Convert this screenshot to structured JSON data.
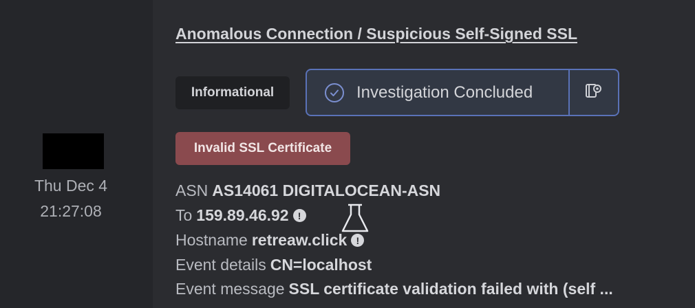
{
  "event": {
    "date": "Thu Dec 4",
    "time": "21:27:08",
    "title": "Anomalous Connection / Suspicious Self-Signed SSL",
    "severity": "Informational",
    "status_label": "Investigation Concluded",
    "tag": "Invalid SSL Certificate",
    "details": {
      "asn_label": "ASN",
      "asn_value": "AS14061 DIGITALOCEAN-ASN",
      "to_label": "To",
      "to_value": "159.89.46.92",
      "hostname_label": "Hostname",
      "hostname_value": "retreaw.click",
      "event_details_label": "Event details",
      "event_details_value": "CN=localhost",
      "event_message_label": "Event message",
      "event_message_value": "SSL certificate validation failed with (self ..."
    },
    "info_glyph": "!"
  },
  "colors": {
    "status_border": "#5a72b8",
    "tag_bg": "#8a4a4e",
    "bg": "#2b2c30"
  },
  "icons": [
    "check-circle-icon",
    "settings-book-icon",
    "info-icon",
    "flask-icon"
  ]
}
